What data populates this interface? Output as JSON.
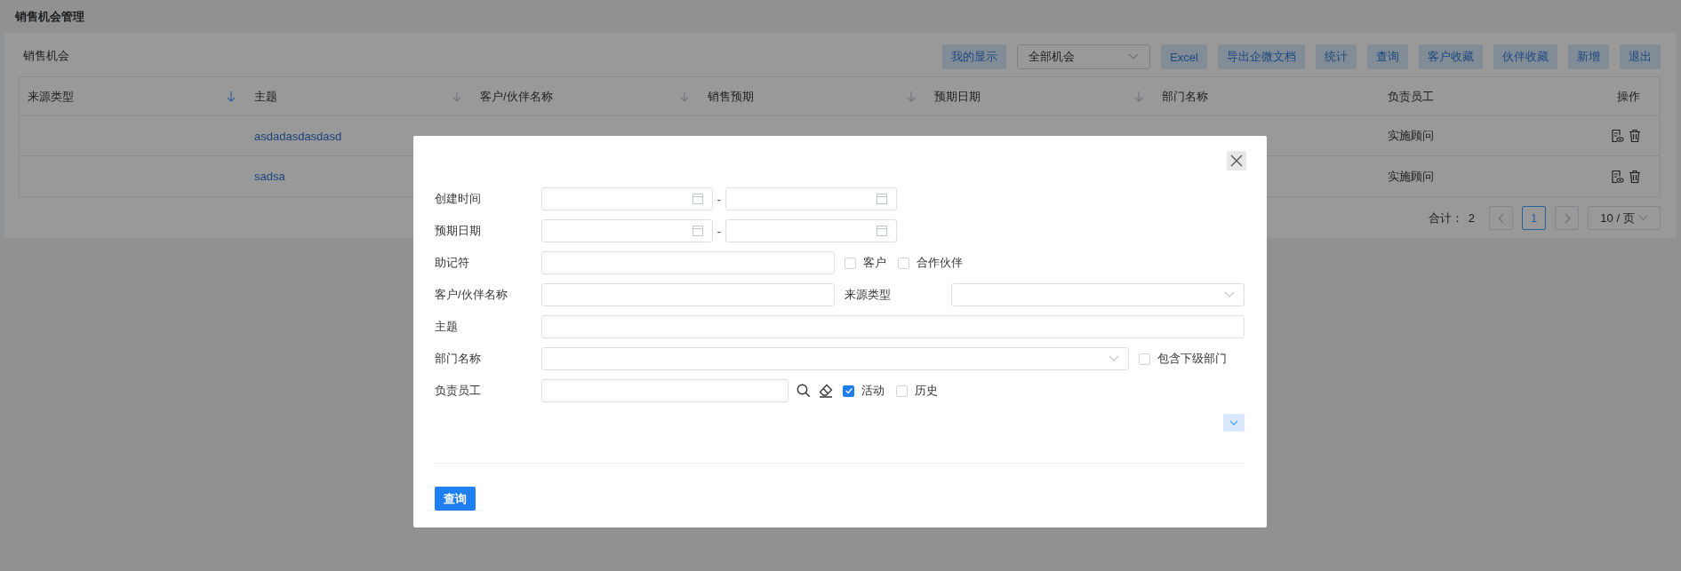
{
  "page": {
    "title": "销售机会管理"
  },
  "panel": {
    "title": "销售机会",
    "toolbar": [
      {
        "kind": "button",
        "label": "我的显示"
      },
      {
        "kind": "select",
        "value": "全部机会"
      },
      {
        "kind": "button",
        "label": "Excel"
      },
      {
        "kind": "button",
        "label": "导出企微文档"
      },
      {
        "kind": "button",
        "label": "统计"
      },
      {
        "kind": "button",
        "label": "查询"
      },
      {
        "kind": "button",
        "label": "客户收藏"
      },
      {
        "kind": "button",
        "label": "伙伴收藏"
      },
      {
        "kind": "button",
        "label": "新增"
      },
      {
        "kind": "button",
        "label": "退出"
      }
    ]
  },
  "table": {
    "columns": [
      {
        "label": "来源类型",
        "sorted": true
      },
      {
        "label": "主题",
        "sorted": false
      },
      {
        "label": "客户/伙伴名称",
        "sorted": false
      },
      {
        "label": "销售预期",
        "sorted": false
      },
      {
        "label": "预期日期",
        "sorted": false
      },
      {
        "label": "部门名称"
      },
      {
        "label": "负责员工"
      },
      {
        "label": "操作"
      }
    ],
    "rows": [
      {
        "subject": "asdadasdasdasd",
        "owner": "实施顾问"
      },
      {
        "subject": "sadsa",
        "owner": "实施顾问"
      }
    ]
  },
  "pagination": {
    "total_label": "合计：",
    "total": "2",
    "pages": [
      {
        "label": "1",
        "selected": true
      }
    ],
    "page_size": "10 / 页"
  },
  "search_dialog": {
    "rows": [
      {
        "kind": "date_range",
        "label": "创建时间",
        "separator": "-"
      },
      {
        "kind": "date_range",
        "label": "预期日期",
        "separator": "-"
      },
      {
        "kind": "text_checks",
        "label": "助记符",
        "checks": [
          {
            "label": "客户",
            "checked": false
          },
          {
            "label": "合作伙伴",
            "checked": false
          }
        ]
      },
      {
        "kind": "text_select",
        "label": "客户/伙伴名称",
        "second_label": "来源类型"
      },
      {
        "kind": "text",
        "label": "主题"
      },
      {
        "kind": "select_checks",
        "label": "部门名称",
        "checks": [
          {
            "label": "包含下级部门",
            "checked": false
          }
        ]
      },
      {
        "kind": "picker_checks",
        "label": "负责员工",
        "checks": [
          {
            "label": "活动",
            "checked": true
          },
          {
            "label": "历史",
            "checked": false
          }
        ]
      }
    ],
    "submit": "查询"
  }
}
